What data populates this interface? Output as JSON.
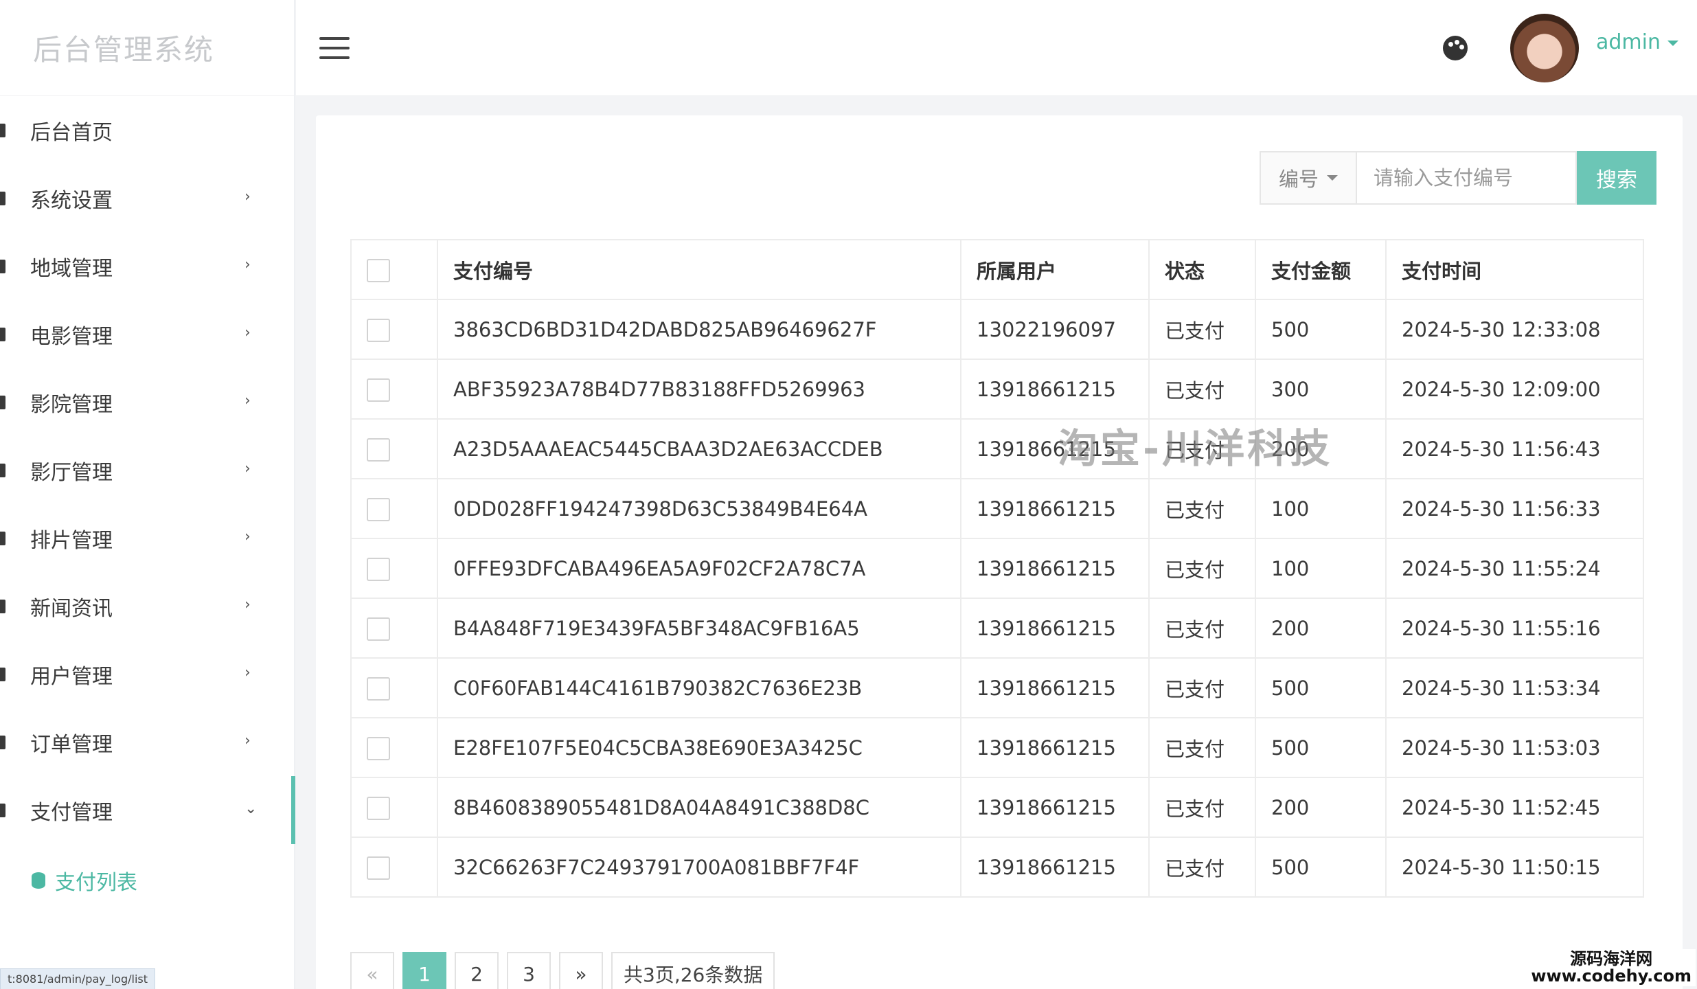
{
  "brand": "后台管理系统",
  "sidebar": {
    "items": [
      {
        "label": "后台首页"
      },
      {
        "label": "系统设置",
        "chevron": "›"
      },
      {
        "label": "地域管理",
        "chevron": "›"
      },
      {
        "label": "电影管理",
        "chevron": "›"
      },
      {
        "label": "影院管理",
        "chevron": "›"
      },
      {
        "label": "影厅管理",
        "chevron": "›"
      },
      {
        "label": "排片管理",
        "chevron": "›"
      },
      {
        "label": "新闻资讯",
        "chevron": "›"
      },
      {
        "label": "用户管理",
        "chevron": "›"
      },
      {
        "label": "订单管理",
        "chevron": "›"
      },
      {
        "label": "支付管理",
        "chevron": "⌄"
      }
    ],
    "sub_item": "支付列表"
  },
  "status_url": "t:8081/admin/pay_log/list",
  "header": {
    "user": "admin"
  },
  "search": {
    "select_value": "编号",
    "placeholder": "请输入支付编号",
    "button": "搜索"
  },
  "table": {
    "headers": [
      "支付编号",
      "所属用户",
      "状态",
      "支付金额",
      "支付时间"
    ],
    "rows": [
      [
        "3863CD6BD31D42DABD825AB96469627F",
        "13022196097",
        "已支付",
        "500",
        "2024-5-30 12:33:08"
      ],
      [
        "ABF35923A78B4D77B83188FFD5269963",
        "13918661215",
        "已支付",
        "300",
        "2024-5-30 12:09:00"
      ],
      [
        "A23D5AAAEAC5445CBAA3D2AE63ACCDEB",
        "13918661215",
        "已支付",
        "200",
        "2024-5-30 11:56:43"
      ],
      [
        "0DD028FF194247398D63C53849B4E64A",
        "13918661215",
        "已支付",
        "100",
        "2024-5-30 11:56:33"
      ],
      [
        "0FFE93DFCABA496EA5A9F02CF2A78C7A",
        "13918661215",
        "已支付",
        "100",
        "2024-5-30 11:55:24"
      ],
      [
        "B4A848F719E3439FA5BF348AC9FB16A5",
        "13918661215",
        "已支付",
        "200",
        "2024-5-30 11:55:16"
      ],
      [
        "C0F60FAB144C4161B790382C7636E23B",
        "13918661215",
        "已支付",
        "500",
        "2024-5-30 11:53:34"
      ],
      [
        "E28FE107F5E04C5CBA38E690E3A3425C",
        "13918661215",
        "已支付",
        "500",
        "2024-5-30 11:53:03"
      ],
      [
        "8B4608389055481D8A04A8491C388D8C",
        "13918661215",
        "已支付",
        "200",
        "2024-5-30 11:52:45"
      ],
      [
        "32C66263F7C2493791700A081BBF7F4F",
        "13918661215",
        "已支付",
        "500",
        "2024-5-30 11:50:15"
      ]
    ]
  },
  "watermark": "淘宝-川洋科技",
  "pagination": {
    "prev": "«",
    "pages": [
      "1",
      "2",
      "3"
    ],
    "next": "»",
    "info": "共3页,26条数据"
  },
  "site_mark": {
    "line1": "源码海洋网",
    "line2": "www.codehy.com"
  },
  "colors": {
    "accent": "#6cc6b6",
    "status_green": "#4caf50",
    "active_bar": "#5bc0b0"
  }
}
